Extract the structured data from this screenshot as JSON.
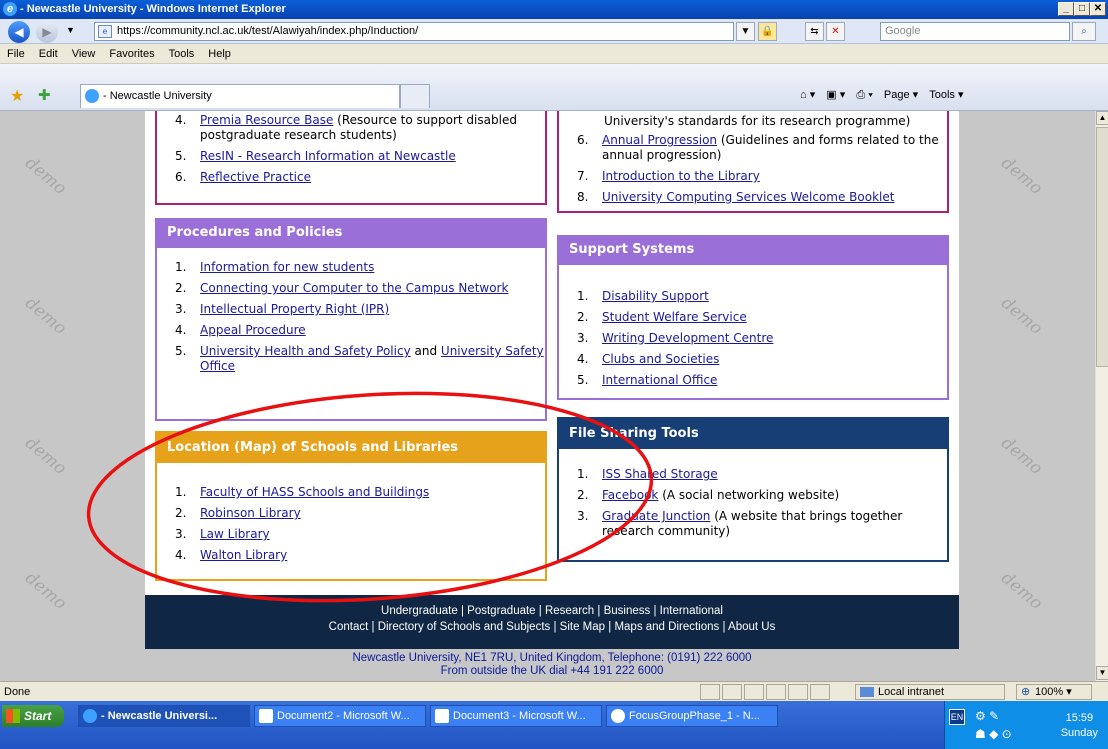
{
  "window": {
    "title": "- Newcastle University - Windows Internet Explorer",
    "minimize": "_",
    "maximize": "□",
    "close": "✕"
  },
  "address_bar": {
    "url": "https://community.ncl.ac.uk/test/Alawiyah/index.php/Induction/",
    "search_placeholder": "Google"
  },
  "menu": [
    "File",
    "Edit",
    "View",
    "Favorites",
    "Tools",
    "Help"
  ],
  "tab": {
    "label": "- Newcastle University"
  },
  "command_bar": {
    "page_label": "Page ▾",
    "tools_label": "Tools ▾"
  },
  "watermark": "demo",
  "panels": {
    "top_left": {
      "items": [
        {
          "num": "4.",
          "link": "Premia Resource Base",
          "suffix": " (Resource to support disabled postgraduate research students)"
        },
        {
          "num": "5.",
          "link": "ResIN - Research Information at Newcastle",
          "suffix": ""
        },
        {
          "num": "6.",
          "link": "Reflective Practice",
          "suffix": ""
        }
      ]
    },
    "top_right": {
      "lead": "University's standards for its research programme)",
      "items": [
        {
          "num": "6.",
          "link": "Annual Progression",
          "suffix": " (Guidelines and forms related to the annual progression)"
        },
        {
          "num": "7.",
          "link": "Introduction to the Library",
          "suffix": ""
        },
        {
          "num": "8.",
          "link": "University Computing Services Welcome Booklet",
          "suffix": ""
        }
      ]
    },
    "procedures": {
      "title": "Procedures and Policies",
      "items": [
        {
          "num": "1.",
          "link": "Information for new students",
          "suffix": ""
        },
        {
          "num": "2.",
          "link": "Connecting your Computer to the Campus Network",
          "suffix": ""
        },
        {
          "num": "3.",
          "link": "Intellectual Property Right (IPR)",
          "suffix": ""
        },
        {
          "num": "4.",
          "link": "Appeal Procedure",
          "suffix": ""
        },
        {
          "num": "5.",
          "link": "University Health and Safety Policy",
          "mid": " and ",
          "link2": "University Safety Office"
        }
      ]
    },
    "support": {
      "title": "Support Systems",
      "items": [
        {
          "num": "1.",
          "link": "Disability Support"
        },
        {
          "num": "2.",
          "link": "Student Welfare Service"
        },
        {
          "num": "3.",
          "link": "Writing Development Centre"
        },
        {
          "num": "4.",
          "link": "Clubs and Societies"
        },
        {
          "num": "5.",
          "link": "International Office"
        }
      ]
    },
    "location": {
      "title": "Location (Map) of Schools and Libraries",
      "items": [
        {
          "num": "1.",
          "link": "Faculty of HASS Schools and Buildings"
        },
        {
          "num": "2.",
          "link": "Robinson Library"
        },
        {
          "num": "3.",
          "link": "Law Library"
        },
        {
          "num": "4.",
          "link": "Walton Library"
        }
      ]
    },
    "file_sharing": {
      "title": "File Sharing Tools",
      "items": [
        {
          "num": "1.",
          "link": "ISS Shared Storage",
          "suffix": ""
        },
        {
          "num": "2.",
          "link": "Facebook",
          "suffix": " (A social networking website)"
        },
        {
          "num": "3.",
          "link": "Graduate Junction",
          "suffix": " (A website that brings together research community)"
        }
      ]
    }
  },
  "footer": {
    "row1": [
      "Undergraduate",
      "Postgraduate",
      "Research",
      "Business",
      "International"
    ],
    "row2": [
      "Contact",
      "Directory of Schools and Subjects",
      "Site Map",
      "Maps and Directions",
      "About Us"
    ],
    "address_name": "Newcastle University",
    "address_line1": ", NE1 7RU, United Kingdom, Telephone: (0191) 222 6000",
    "address_line2": "From outside the UK dial +44 191 222 6000"
  },
  "status": {
    "left": "Done",
    "zone": "Local intranet",
    "zoom": "100%"
  },
  "taskbar": {
    "start": "Start",
    "tasks": [
      "- Newcastle Universi...",
      "Document2 - Microsoft W...",
      "Document3 - Microsoft W...",
      "FocusGroupPhase_1 - N..."
    ],
    "lang": "EN",
    "time": "15:59",
    "day": "Sunday"
  },
  "colors": {
    "purple": "#9b6fd8",
    "orange": "#e6a21b",
    "navy": "#173f75",
    "magenta": "#b0206e",
    "annotation_red": "#e81010"
  }
}
